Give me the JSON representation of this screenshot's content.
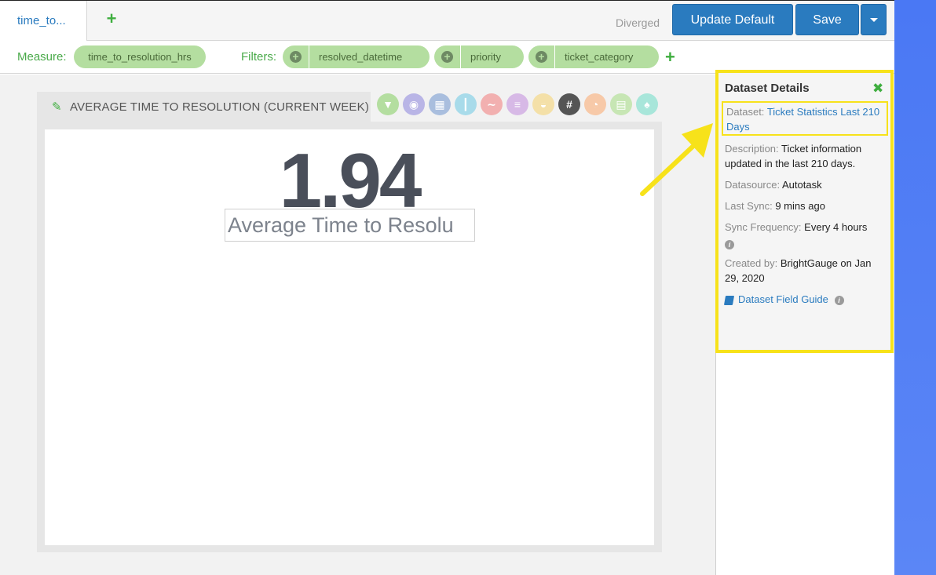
{
  "tabs": {
    "active_label": "time_to...",
    "add_symbol": "+"
  },
  "header": {
    "status": "Diverged",
    "update_default_label": "Update Default",
    "save_label": "Save"
  },
  "measure": {
    "label": "Measure:",
    "value": "time_to_resolution_hrs"
  },
  "filters": {
    "label": "Filters:",
    "items": [
      {
        "label": "resolved_datetime"
      },
      {
        "label": "priority"
      },
      {
        "label": "ticket_category"
      }
    ],
    "add_symbol": "+"
  },
  "widget": {
    "title": "AVERAGE TIME TO RESOLUTION (CURRENT WEEK)",
    "value": "1.94",
    "caption": "Average Time to Resolu",
    "viz_icons": [
      {
        "name": "funnel-viz-icon",
        "color": "#b4dea0",
        "glyph": "▼"
      },
      {
        "name": "camera-viz-icon",
        "color": "#b9b5e6",
        "glyph": "◉"
      },
      {
        "name": "table-viz-icon",
        "color": "#a9bede",
        "glyph": "▦"
      },
      {
        "name": "bar-viz-icon",
        "color": "#a8dbea",
        "glyph": "┃"
      },
      {
        "name": "line-viz-icon",
        "color": "#f2b0b0",
        "glyph": "∼"
      },
      {
        "name": "list-viz-icon",
        "color": "#d7b9e6",
        "glyph": "≡"
      },
      {
        "name": "gauge-viz-icon",
        "color": "#f4e0a8",
        "glyph": "◒"
      },
      {
        "name": "number-viz-icon",
        "color": "#555555",
        "glyph": "#"
      },
      {
        "name": "speedometer-viz-icon",
        "color": "#f7c9a8",
        "glyph": "◔"
      },
      {
        "name": "card-viz-icon",
        "color": "#c7e6b4",
        "glyph": "▤"
      },
      {
        "name": "trophy-viz-icon",
        "color": "#a8e6da",
        "glyph": "♠"
      }
    ]
  },
  "details": {
    "title": "Dataset Details",
    "close_symbol": "✖",
    "dataset_key": "Dataset:",
    "dataset_value": "Ticket Statistics Last 210 Days",
    "description_key": "Description:",
    "description_value": "Ticket information updated in the last 210 days.",
    "datasource_key": "Datasource:",
    "datasource_value": "Autotask",
    "last_sync_key": "Last Sync:",
    "last_sync_value": "9 mins ago",
    "sync_freq_key": "Sync Frequency:",
    "sync_freq_value": "Every 4 hours",
    "created_key": "Created by:",
    "created_value": "BrightGauge on Jan 29, 2020",
    "field_guide": "Dataset Field Guide"
  },
  "colors": {
    "accent_blue": "#2a7bbf",
    "green": "#3fae3f",
    "highlight_yellow": "#f7e21a"
  }
}
